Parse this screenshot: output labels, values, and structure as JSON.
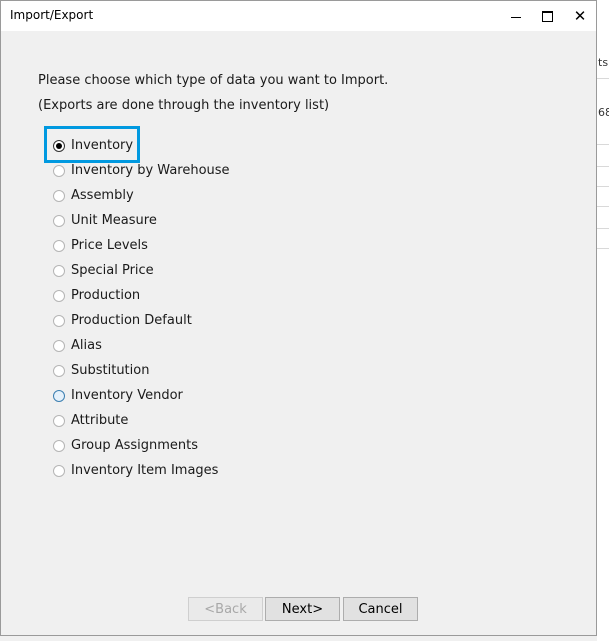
{
  "window": {
    "title": "Import/Export",
    "close_glyph": "✕"
  },
  "background_app": {
    "fragment1": "ts",
    "fragment2": "68"
  },
  "intro": {
    "line1": "Please choose which type of data you want to Import.",
    "line2": "(Exports are done through the inventory list)"
  },
  "options": [
    {
      "label": "Inventory",
      "selected": true
    },
    {
      "label": "Inventory by Warehouse",
      "selected": false
    },
    {
      "label": "Assembly",
      "selected": false
    },
    {
      "label": "Unit Measure",
      "selected": false
    },
    {
      "label": "Price Levels",
      "selected": false
    },
    {
      "label": "Special Price",
      "selected": false
    },
    {
      "label": "Production",
      "selected": false
    },
    {
      "label": "Production Default",
      "selected": false
    },
    {
      "label": "Alias",
      "selected": false
    },
    {
      "label": "Substitution",
      "selected": false
    },
    {
      "label": "Inventory Vendor",
      "selected": false,
      "hovered": true
    },
    {
      "label": "Attribute",
      "selected": false
    },
    {
      "label": "Group Assignments",
      "selected": false
    },
    {
      "label": "Inventory Item Images",
      "selected": false
    }
  ],
  "buttons": {
    "back": {
      "label": "<Back",
      "enabled": false
    },
    "next": {
      "label": "Next>",
      "enabled": true
    },
    "cancel": {
      "label": "Cancel",
      "enabled": true
    }
  },
  "colors": {
    "focus_highlight": "#0099e0",
    "dialog_background": "#f0f0f0"
  }
}
